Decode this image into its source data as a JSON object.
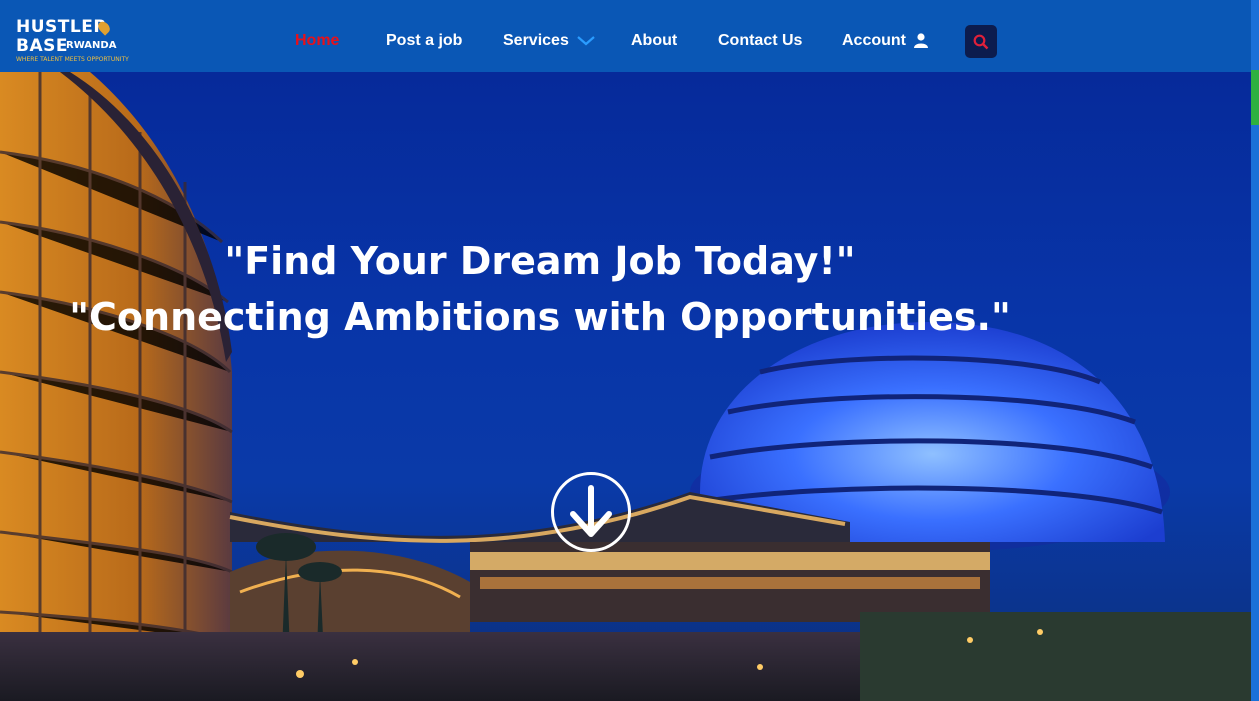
{
  "logo": {
    "line1": "HUSTLER",
    "line2": "BASE",
    "line3": "RWANDA",
    "tagline": "WHERE TALENT MEETS OPPORTUNITY"
  },
  "nav": {
    "home": "Home",
    "post_job": "Post a job",
    "services": "Services",
    "about": "About",
    "contact": "Contact Us",
    "account": "Account"
  },
  "hero": {
    "headline1": "\"Find Your Dream Job Today!\"",
    "headline2": "\"Connecting Ambitions with Opportunities.\""
  },
  "colors": {
    "nav_bg": "#0a57b5",
    "active": "#e8101a",
    "search_bg": "#0c1c4e"
  }
}
